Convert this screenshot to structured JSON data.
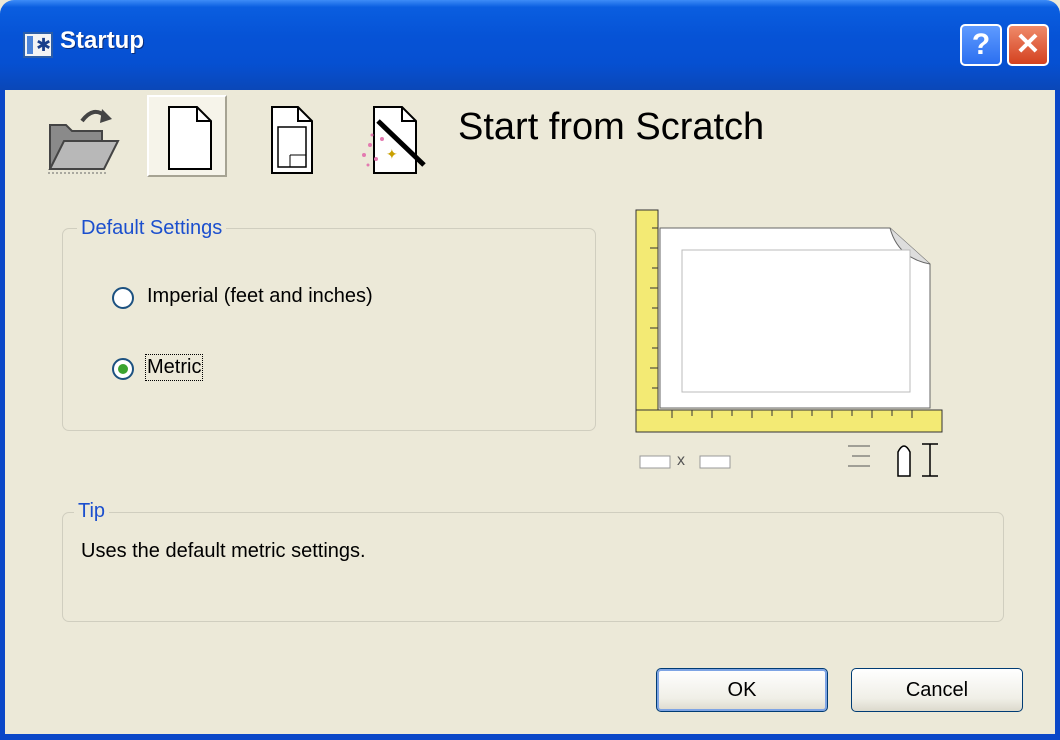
{
  "window": {
    "title": "Startup"
  },
  "toolbar": {
    "items": [
      {
        "name": "open-drawing",
        "icon": "folder-open-icon",
        "active": false
      },
      {
        "name": "start-from-scratch",
        "icon": "blank-page-icon",
        "active": true
      },
      {
        "name": "use-template",
        "icon": "template-page-icon",
        "active": false
      },
      {
        "name": "use-wizard",
        "icon": "wizard-page-icon",
        "active": false
      }
    ]
  },
  "main": {
    "heading": "Start from Scratch"
  },
  "settings": {
    "group_title": "Default Settings",
    "options": [
      {
        "label": "Imperial (feet and inches)",
        "selected": false
      },
      {
        "label": "Metric",
        "selected": true
      }
    ]
  },
  "preview": {
    "size_separator": "x"
  },
  "tip": {
    "title": "Tip",
    "text": "Uses the default metric settings."
  },
  "buttons": {
    "ok": "OK",
    "cancel": "Cancel"
  },
  "colors": {
    "titlebar": "#0653d6",
    "dialog_bg": "#ece9d8",
    "group_title": "#1b4fce",
    "ruler": "#f3ea74"
  }
}
